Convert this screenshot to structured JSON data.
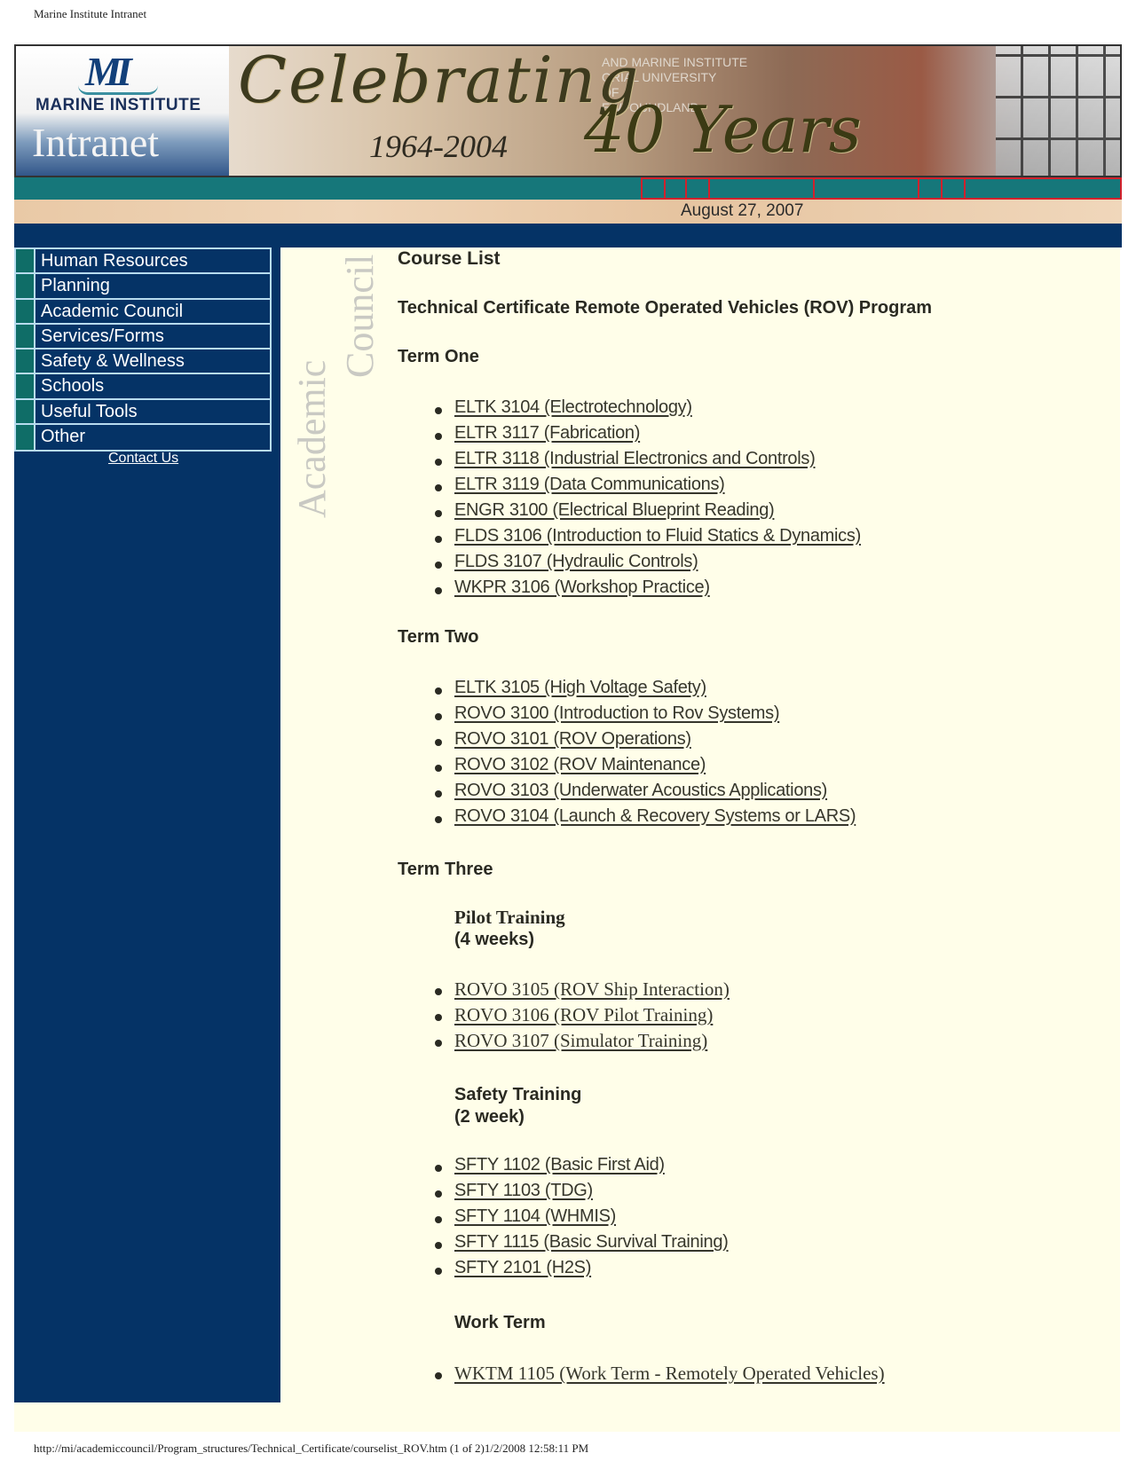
{
  "print": {
    "header": "Marine Institute Intranet",
    "footer": "http://mi/academiccouncil/Program_structures/Technical_Certificate/courselist_ROV.htm (1 of 2)1/2/2008 12:58:11 PM"
  },
  "banner": {
    "logo_mark": "MI",
    "logo_name": "Marine Institute",
    "logo_subtitle": "Intranet",
    "celebrating": "Celebrating",
    "years_range": "1964-2004",
    "forty_years": "40 Years",
    "sign_text": "AND MARINE INSTITUTE\nORIAL UNIVERSITY\nOF\nEWFOUNDLAND",
    "date": "August 27, 2007"
  },
  "colors": {
    "navy": "#053366",
    "teal": "#16777a",
    "nav_border": "#b8dcef",
    "page_bg": "#fffee9",
    "highlight_border": "#d0212c"
  },
  "sidebar": {
    "items": [
      {
        "label": "Human Resources"
      },
      {
        "label": "Planning"
      },
      {
        "label": "Academic Council"
      },
      {
        "label": "Services/Forms"
      },
      {
        "label": "Safety & Wellness"
      },
      {
        "label": "Schools"
      },
      {
        "label": "Useful Tools"
      },
      {
        "label": "Other"
      }
    ],
    "contact": "Contact Us"
  },
  "watermark": {
    "word1": "Academic",
    "word2": "Council"
  },
  "content": {
    "title": "Course List",
    "program": "Technical Certificate Remote Operated Vehicles (ROV) Program",
    "terms": [
      {
        "heading": "Term One",
        "courses": [
          "ELTK 3104 (Electrotechnology)",
          "ELTR 3117 (Fabrication)",
          "ELTR 3118 (Industrial Electronics and Controls)",
          "ELTR 3119 (Data Communications) ",
          "ENGR 3100 (Electrical Blueprint Reading)",
          "FLDS 3106 (Introduction to Fluid Statics & Dynamics)",
          "FLDS 3107 (Hydraulic Controls)",
          "WKPR 3106 (Workshop Practice) "
        ]
      },
      {
        "heading": "Term Two",
        "courses": [
          "ELTK 3105 (High Voltage Safety)",
          "ROVO 3100 (Introduction to Rov Systems)",
          "ROVO 3101 (ROV Operations)",
          "ROVO 3102 (ROV Maintenance)",
          "ROVO 3103 (Underwater Acoustics Applications)",
          "ROVO 3104 (Launch & Recovery Systems or LARS)"
        ]
      },
      {
        "heading": "Term Three",
        "sections": [
          {
            "title": "Pilot Training",
            "duration": "(4 weeks)",
            "courses": [
              "ROVO 3105 (ROV Ship Interaction)",
              "ROVO 3106 (ROV Pilot Training)",
              "ROVO 3107 (Simulator Training)"
            ]
          },
          {
            "title": "Safety Training",
            "duration": "(2 week)",
            "courses": [
              "SFTY 1102 (Basic First Aid)",
              "SFTY 1103 (TDG)",
              "SFTY 1104 (WHMIS)",
              "SFTY 1115 (Basic Survival Training)",
              "SFTY 2101 (H2S)"
            ]
          },
          {
            "title": "Work Term",
            "duration": "",
            "courses": [
              "WKTM 1105 (Work Term - Remotely Operated Vehicles)"
            ]
          }
        ]
      }
    ]
  }
}
